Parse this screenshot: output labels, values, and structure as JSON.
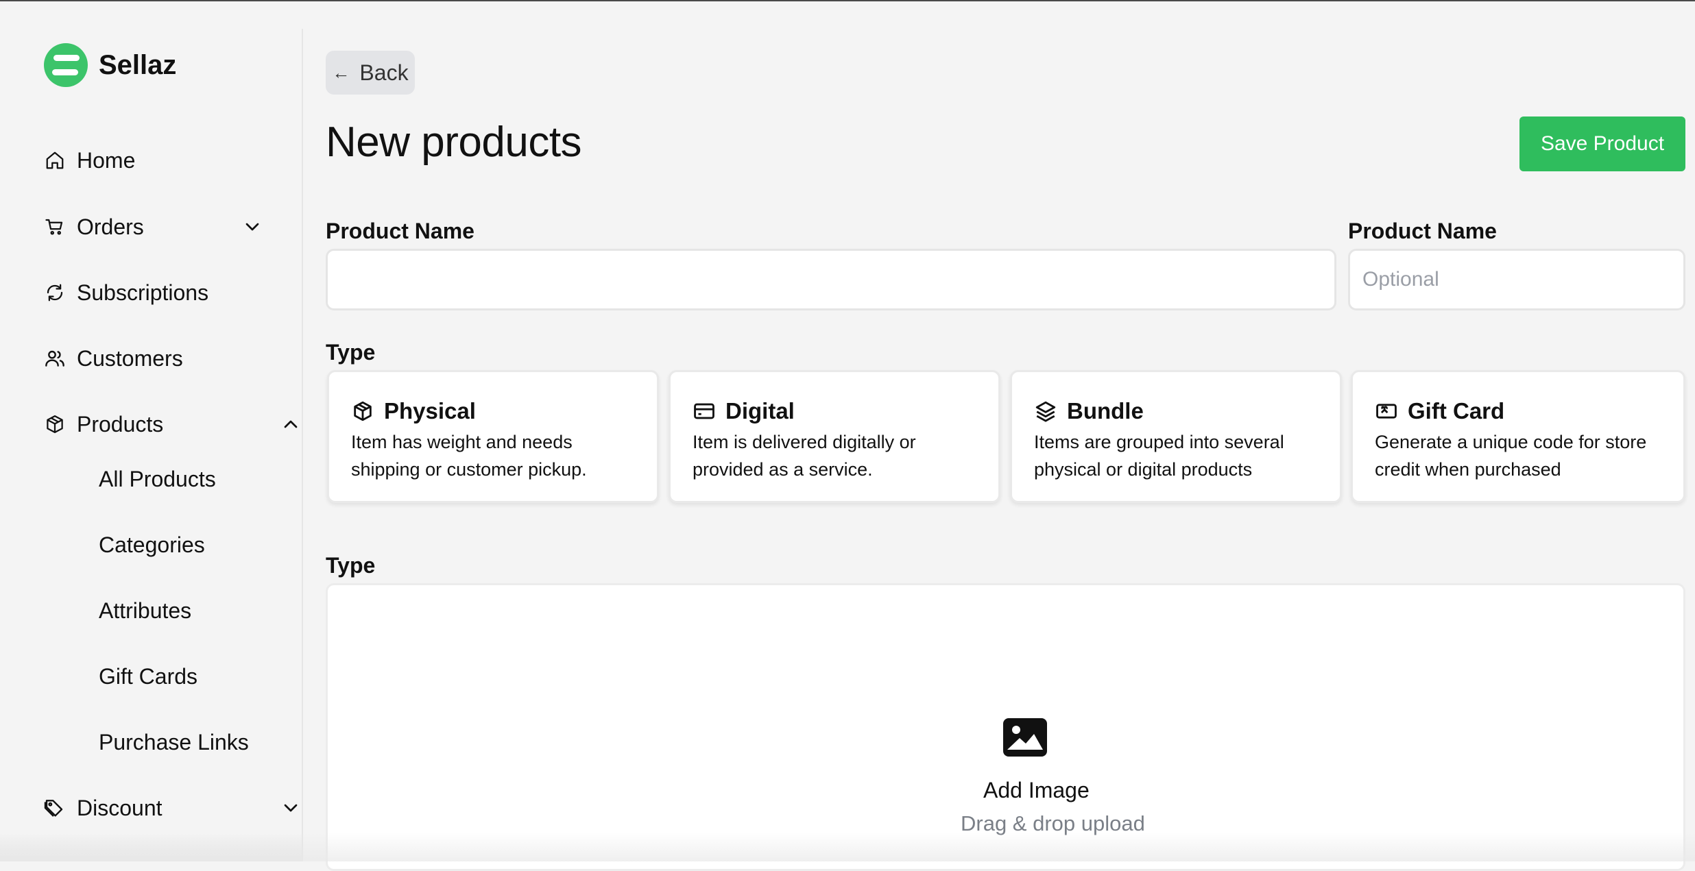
{
  "brand": {
    "name": "Sellaz",
    "logo_icon": "sellaz-logo-icon",
    "logo_color": "#3cc46a"
  },
  "sidebar": {
    "items": [
      {
        "label": "Home",
        "icon": "home-icon"
      },
      {
        "label": "Orders",
        "icon": "cart-icon",
        "expanded": false
      },
      {
        "label": "Subscriptions",
        "icon": "refresh-icon"
      },
      {
        "label": "Customers",
        "icon": "users-icon"
      },
      {
        "label": "Products",
        "icon": "box-icon",
        "expanded": true
      },
      {
        "label": "Discount",
        "icon": "tag-icon",
        "expanded": false
      }
    ],
    "products_subitems": [
      "All Products",
      "Categories",
      "Attributes",
      "Gift Cards",
      "Purchase Links"
    ]
  },
  "header": {
    "back_label": "Back",
    "title": "New products",
    "save_label": "Save Product"
  },
  "form": {
    "product_name": {
      "label": "Product Name",
      "value": "",
      "placeholder": ""
    },
    "product_name_optional": {
      "label": "Product Name",
      "value": "",
      "placeholder": "Optional"
    },
    "type_label": "Type",
    "types": [
      {
        "title": "Physical",
        "icon": "package-icon",
        "desc_line1": "Item has weight and needs",
        "desc_line2": "shipping or customer pickup."
      },
      {
        "title": "Digital",
        "icon": "credit-card-icon",
        "desc_line1": "Item is delivered digitally or",
        "desc_line2": "provided as a service."
      },
      {
        "title": "Bundle",
        "icon": "layers-icon",
        "desc_line1": "Items are grouped into several",
        "desc_line2": "physical or digital products"
      },
      {
        "title": "Gift Card",
        "icon": "gift-card-icon",
        "desc_line1": "Generate a unique code for store",
        "desc_line2": "credit when purchased"
      }
    ],
    "image_section_label": "Type",
    "upload": {
      "title": "Add Image",
      "subtitle": "Drag & drop upload",
      "icon": "image-icon"
    }
  },
  "colors": {
    "accent": "#2fbd5d",
    "background": "#f4f4f4",
    "card": "#ffffff",
    "muted_text": "#7a7f87"
  }
}
